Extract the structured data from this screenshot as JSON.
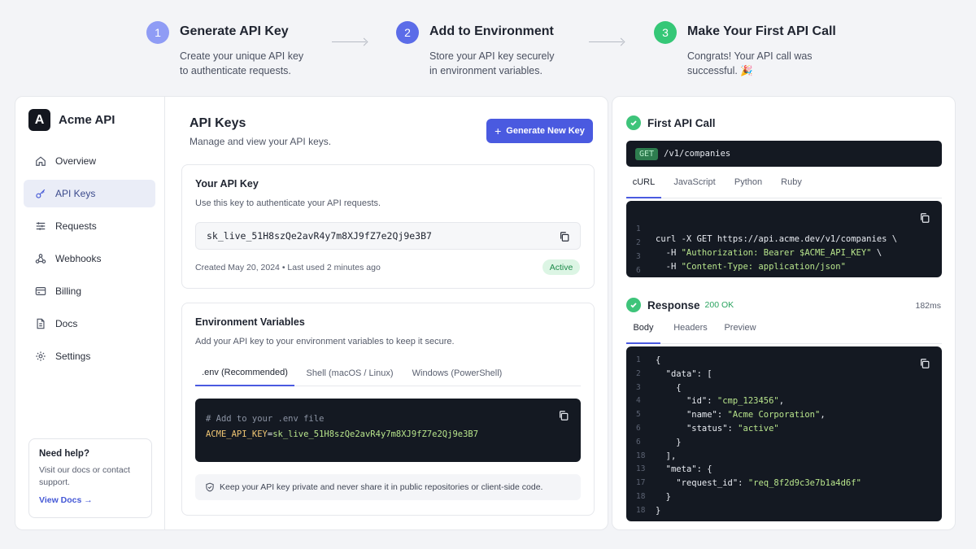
{
  "steps": [
    {
      "num": "1",
      "title": "Generate API Key",
      "desc": "Create your unique API key to authenticate requests.",
      "color": "#8f9cf5"
    },
    {
      "num": "2",
      "title": "Add to Environment",
      "desc": "Store your API key securely in environment variables.",
      "color": "#5b6ce8"
    },
    {
      "num": "3",
      "title": "Make Your First API Call",
      "desc": "Congrats! Your API call was successful. 🎉",
      "color": "#35c777"
    }
  ],
  "sidebar": {
    "logo_letter": "A",
    "app_name": "Acme API",
    "items": [
      {
        "label": "Overview",
        "icon": "home-icon"
      },
      {
        "label": "API Keys",
        "icon": "key-icon",
        "active": true
      },
      {
        "label": "Requests",
        "icon": "list-icon"
      },
      {
        "label": "Webhooks",
        "icon": "webhook-icon"
      },
      {
        "label": "Billing",
        "icon": "credit-card-icon"
      },
      {
        "label": "Docs",
        "icon": "document-icon"
      },
      {
        "label": "Settings",
        "icon": "gear-icon"
      }
    ],
    "help": {
      "title": "Need help?",
      "desc": "Visit our docs or contact support.",
      "link": "View Docs →"
    }
  },
  "main": {
    "title": "API Keys",
    "subtitle": "Manage and view your API keys.",
    "generate_button": "Generate New Key",
    "key_card": {
      "title": "Your API Key",
      "subtitle": "Use this key to authenticate your API requests.",
      "key": "sk_live_51H8szQe2avR4y7m8XJ9fZ7e2Qj9e3B7",
      "meta": "Created May 20, 2024  •  Last used 2 minutes ago",
      "status": "Active"
    },
    "env_card": {
      "title": "Environment Variables",
      "subtitle": "Add your API key to your environment variables to keep it secure.",
      "tabs": [
        ".env (Recommended)",
        "Shell (macOS / Linux)",
        "Windows (PowerShell)"
      ],
      "active_tab": 0,
      "code_comment": "# Add to your .env file",
      "code_var": "ACME_API_KEY",
      "code_eq": "=",
      "code_value": "sk_live_51H8szQe2avR4y7m8XJ9fZ7e2Qj9e3B7",
      "note": "Keep your API key private and never share it in public repositories or client-side code."
    }
  },
  "right": {
    "first_call": {
      "title": "First API Call",
      "method": "GET",
      "path": "/v1/companies",
      "tabs": [
        "cURL",
        "JavaScript",
        "Python",
        "Ruby"
      ],
      "active_tab": 0,
      "code_lines": [
        {
          "n": "1",
          "text": "curl -X GET https://api.acme.dev/v1/companies \\"
        },
        {
          "n": "2",
          "pre": "  -H ",
          "str": "\"Authorization: Bearer $ACME_API_KEY\"",
          "post": " \\"
        },
        {
          "n": "3",
          "pre": "  -H ",
          "str": "\"Content-Type: application/json\"",
          "post": ""
        },
        {
          "n": "6",
          "text": ""
        }
      ]
    },
    "response": {
      "title": "Response",
      "status": "200 OK",
      "latency": "182ms",
      "tabs": [
        "Body",
        "Headers",
        "Preview"
      ],
      "active_tab": 0,
      "code_lines": [
        {
          "n": "1",
          "pre": "{"
        },
        {
          "n": "2",
          "pre": "  ",
          "key": "\"data\"",
          "post": ": ["
        },
        {
          "n": "3",
          "pre": "    {"
        },
        {
          "n": "4",
          "pre": "      ",
          "key": "\"id\"",
          "post": ": ",
          "str": "\"cmp_123456\"",
          "end": ","
        },
        {
          "n": "5",
          "pre": "      ",
          "key": "\"name\"",
          "post": ": ",
          "str": "\"Acme Corporation\"",
          "end": ","
        },
        {
          "n": "6",
          "pre": "      ",
          "key": "\"status\"",
          "post": ": ",
          "str": "\"active\""
        },
        {
          "n": "6",
          "pre": "    }"
        },
        {
          "n": "18",
          "pre": "  ],"
        },
        {
          "n": "13",
          "pre": "  ",
          "key": "\"meta\"",
          "post": ": {"
        },
        {
          "n": "17",
          "pre": "    ",
          "key": "\"request_id\"",
          "post": ": ",
          "str": "\"req_8f2d9c3e7b1a4d6f\""
        },
        {
          "n": "18",
          "pre": "  }"
        },
        {
          "n": "18",
          "pre": "}"
        }
      ]
    }
  }
}
